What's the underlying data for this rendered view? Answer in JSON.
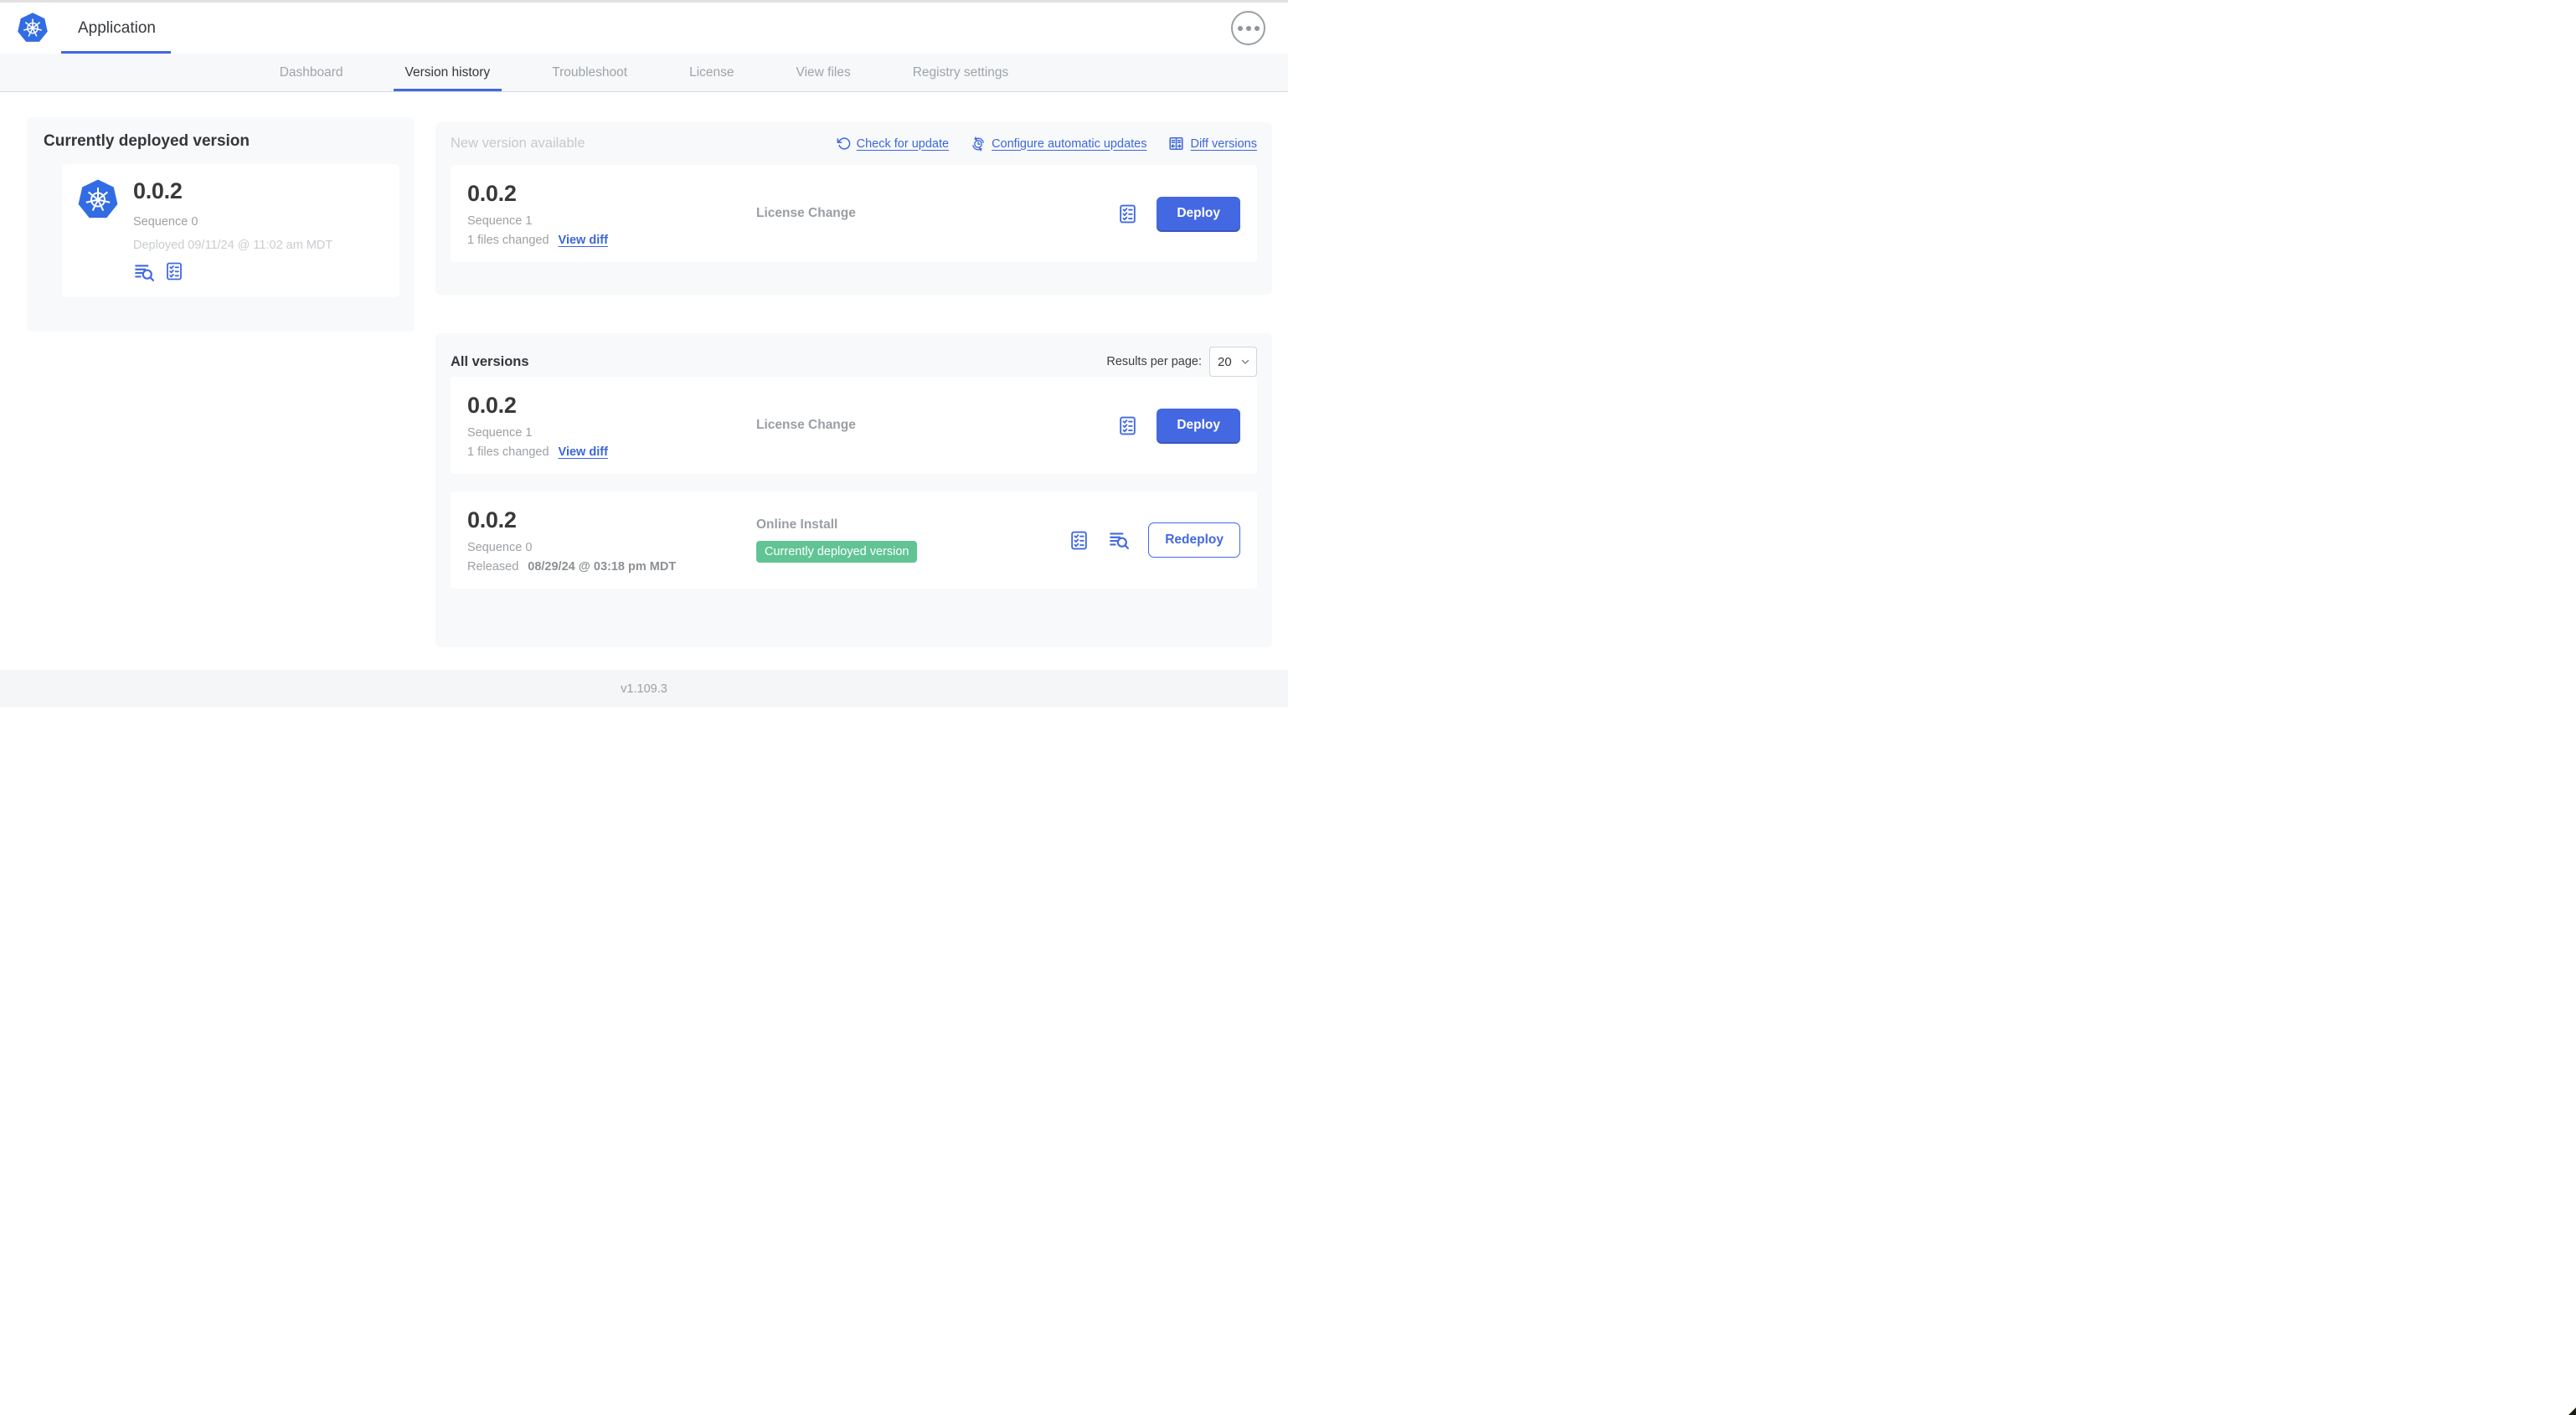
{
  "app": {
    "title": "Application",
    "footer_version": "v1.109.3"
  },
  "nav_tabs": [
    {
      "label": "Dashboard"
    },
    {
      "label": "Version history"
    },
    {
      "label": "Troubleshoot"
    },
    {
      "label": "License"
    },
    {
      "label": "View files"
    },
    {
      "label": "Registry settings"
    }
  ],
  "currently_deployed": {
    "title": "Currently deployed version",
    "version": "0.0.2",
    "sequence": "Sequence 0",
    "deployed_timestamp": "Deployed 09/11/24 @ 11:02 am MDT",
    "icons": [
      "release-notes-icon",
      "preflight-checks-icon"
    ]
  },
  "new_version": {
    "title": "New version available",
    "check_for_update": "Check for update",
    "configure_automatic_updates": "Configure automatic updates",
    "diff_versions": "Diff versions",
    "card": {
      "version": "0.0.2",
      "sequence": "Sequence 1",
      "files_changed": "1 files changed",
      "view_diff": "View diff",
      "source": "License Change",
      "deploy": "Deploy"
    }
  },
  "all_versions": {
    "title": "All versions",
    "results_per_page_label": "Results per page:",
    "results_per_page": "20",
    "rows": [
      {
        "version": "0.0.2",
        "sequence": "Sequence 1",
        "files_changed": "1 files changed",
        "view_diff": "View diff",
        "source": "License Change",
        "action": "Deploy"
      },
      {
        "version": "0.0.2",
        "sequence": "Sequence 0",
        "released_label": "Released",
        "released_timestamp": "08/29/24 @ 03:18 pm MDT",
        "source": "Online Install",
        "badge": "Currently deployed version",
        "action": "Redeploy"
      }
    ]
  },
  "colors": {
    "accent_blue": "#4468e2",
    "kubernetes_blue": "#326ce5",
    "badge_green": "#61c494",
    "muted_text": "#9da1a5",
    "faint_text": "#c9ccd0",
    "panel_bg": "#f8f9fa"
  }
}
